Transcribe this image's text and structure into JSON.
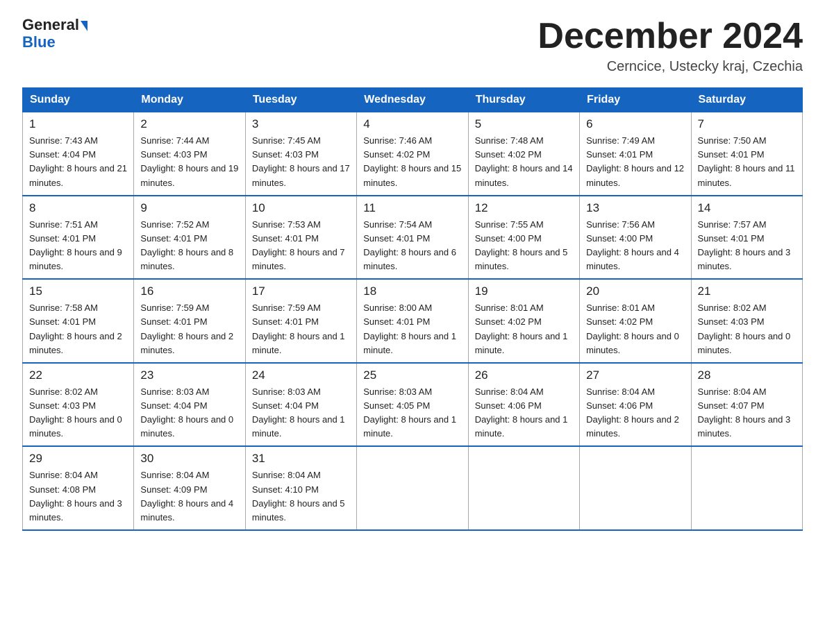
{
  "logo": {
    "general": "General",
    "triangle": "▶",
    "blue": "Blue"
  },
  "title": "December 2024",
  "subtitle": "Cerncice, Ustecky kraj, Czechia",
  "days_header": [
    "Sunday",
    "Monday",
    "Tuesday",
    "Wednesday",
    "Thursday",
    "Friday",
    "Saturday"
  ],
  "weeks": [
    [
      {
        "day": "1",
        "sunrise": "7:43 AM",
        "sunset": "4:04 PM",
        "daylight": "8 hours and 21 minutes."
      },
      {
        "day": "2",
        "sunrise": "7:44 AM",
        "sunset": "4:03 PM",
        "daylight": "8 hours and 19 minutes."
      },
      {
        "day": "3",
        "sunrise": "7:45 AM",
        "sunset": "4:03 PM",
        "daylight": "8 hours and 17 minutes."
      },
      {
        "day": "4",
        "sunrise": "7:46 AM",
        "sunset": "4:02 PM",
        "daylight": "8 hours and 15 minutes."
      },
      {
        "day": "5",
        "sunrise": "7:48 AM",
        "sunset": "4:02 PM",
        "daylight": "8 hours and 14 minutes."
      },
      {
        "day": "6",
        "sunrise": "7:49 AM",
        "sunset": "4:01 PM",
        "daylight": "8 hours and 12 minutes."
      },
      {
        "day": "7",
        "sunrise": "7:50 AM",
        "sunset": "4:01 PM",
        "daylight": "8 hours and 11 minutes."
      }
    ],
    [
      {
        "day": "8",
        "sunrise": "7:51 AM",
        "sunset": "4:01 PM",
        "daylight": "8 hours and 9 minutes."
      },
      {
        "day": "9",
        "sunrise": "7:52 AM",
        "sunset": "4:01 PM",
        "daylight": "8 hours and 8 minutes."
      },
      {
        "day": "10",
        "sunrise": "7:53 AM",
        "sunset": "4:01 PM",
        "daylight": "8 hours and 7 minutes."
      },
      {
        "day": "11",
        "sunrise": "7:54 AM",
        "sunset": "4:01 PM",
        "daylight": "8 hours and 6 minutes."
      },
      {
        "day": "12",
        "sunrise": "7:55 AM",
        "sunset": "4:00 PM",
        "daylight": "8 hours and 5 minutes."
      },
      {
        "day": "13",
        "sunrise": "7:56 AM",
        "sunset": "4:00 PM",
        "daylight": "8 hours and 4 minutes."
      },
      {
        "day": "14",
        "sunrise": "7:57 AM",
        "sunset": "4:01 PM",
        "daylight": "8 hours and 3 minutes."
      }
    ],
    [
      {
        "day": "15",
        "sunrise": "7:58 AM",
        "sunset": "4:01 PM",
        "daylight": "8 hours and 2 minutes."
      },
      {
        "day": "16",
        "sunrise": "7:59 AM",
        "sunset": "4:01 PM",
        "daylight": "8 hours and 2 minutes."
      },
      {
        "day": "17",
        "sunrise": "7:59 AM",
        "sunset": "4:01 PM",
        "daylight": "8 hours and 1 minute."
      },
      {
        "day": "18",
        "sunrise": "8:00 AM",
        "sunset": "4:01 PM",
        "daylight": "8 hours and 1 minute."
      },
      {
        "day": "19",
        "sunrise": "8:01 AM",
        "sunset": "4:02 PM",
        "daylight": "8 hours and 1 minute."
      },
      {
        "day": "20",
        "sunrise": "8:01 AM",
        "sunset": "4:02 PM",
        "daylight": "8 hours and 0 minutes."
      },
      {
        "day": "21",
        "sunrise": "8:02 AM",
        "sunset": "4:03 PM",
        "daylight": "8 hours and 0 minutes."
      }
    ],
    [
      {
        "day": "22",
        "sunrise": "8:02 AM",
        "sunset": "4:03 PM",
        "daylight": "8 hours and 0 minutes."
      },
      {
        "day": "23",
        "sunrise": "8:03 AM",
        "sunset": "4:04 PM",
        "daylight": "8 hours and 0 minutes."
      },
      {
        "day": "24",
        "sunrise": "8:03 AM",
        "sunset": "4:04 PM",
        "daylight": "8 hours and 1 minute."
      },
      {
        "day": "25",
        "sunrise": "8:03 AM",
        "sunset": "4:05 PM",
        "daylight": "8 hours and 1 minute."
      },
      {
        "day": "26",
        "sunrise": "8:04 AM",
        "sunset": "4:06 PM",
        "daylight": "8 hours and 1 minute."
      },
      {
        "day": "27",
        "sunrise": "8:04 AM",
        "sunset": "4:06 PM",
        "daylight": "8 hours and 2 minutes."
      },
      {
        "day": "28",
        "sunrise": "8:04 AM",
        "sunset": "4:07 PM",
        "daylight": "8 hours and 3 minutes."
      }
    ],
    [
      {
        "day": "29",
        "sunrise": "8:04 AM",
        "sunset": "4:08 PM",
        "daylight": "8 hours and 3 minutes."
      },
      {
        "day": "30",
        "sunrise": "8:04 AM",
        "sunset": "4:09 PM",
        "daylight": "8 hours and 4 minutes."
      },
      {
        "day": "31",
        "sunrise": "8:04 AM",
        "sunset": "4:10 PM",
        "daylight": "8 hours and 5 minutes."
      },
      null,
      null,
      null,
      null
    ]
  ]
}
